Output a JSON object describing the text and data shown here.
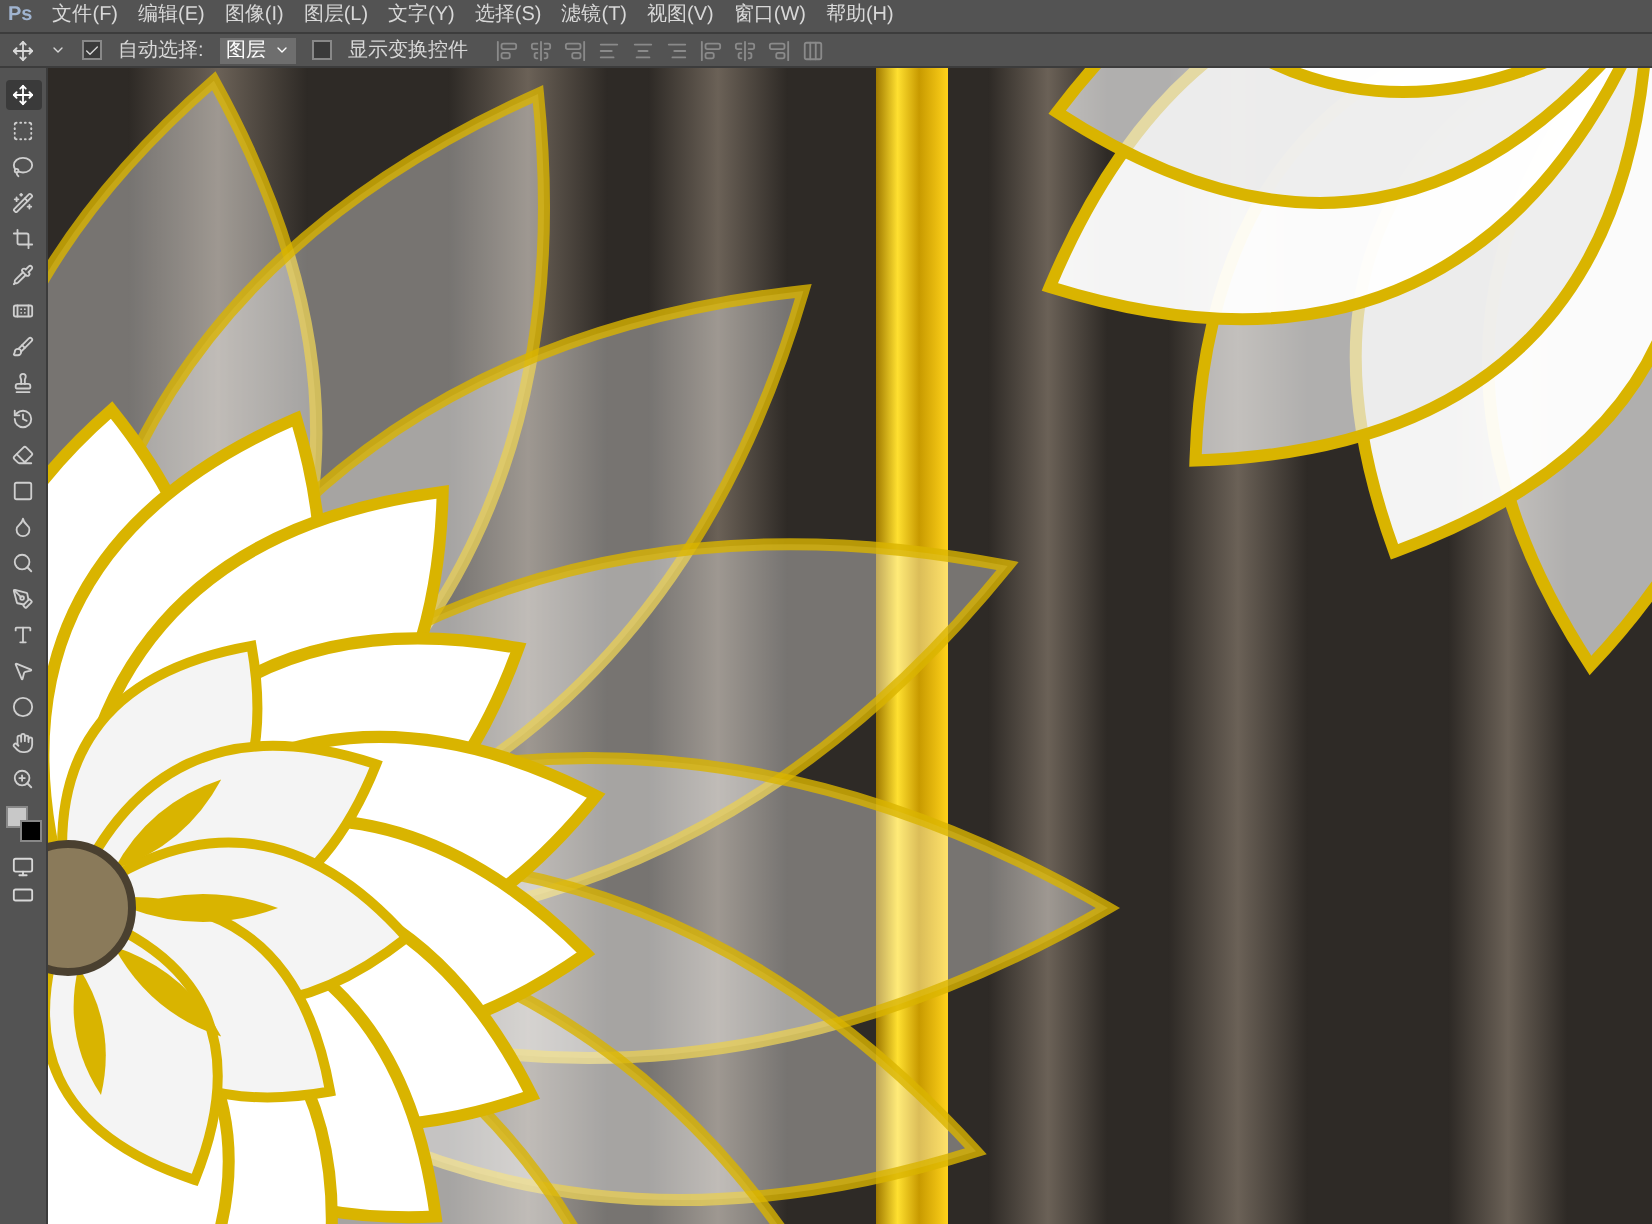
{
  "app_logo": "Ps",
  "menu": [
    "文件(F)",
    "编辑(E)",
    "图像(I)",
    "图层(L)",
    "文字(Y)",
    "选择(S)",
    "滤镜(T)",
    "视图(V)",
    "窗口(W)",
    "帮助(H)"
  ],
  "options_bar": {
    "auto_select": {
      "label": "自动选择:",
      "checked": true
    },
    "target": {
      "value": "图层"
    },
    "show_transform": {
      "label": "显示变换控件",
      "checked": false
    }
  },
  "tools": [
    {
      "kind": "move",
      "selected": true
    },
    {
      "kind": "marquee",
      "selected": false
    },
    {
      "kind": "lasso",
      "selected": false
    },
    {
      "kind": "quick_select",
      "selected": false
    },
    {
      "kind": "crop",
      "selected": false
    },
    {
      "kind": "eyedropper",
      "selected": false
    },
    {
      "kind": "healing",
      "selected": false
    },
    {
      "kind": "brush",
      "selected": false
    },
    {
      "kind": "stamp",
      "selected": false
    },
    {
      "kind": "history",
      "selected": false
    },
    {
      "kind": "eraser",
      "selected": false
    },
    {
      "kind": "gradient",
      "selected": false
    },
    {
      "kind": "blur",
      "selected": false
    },
    {
      "kind": "dodge",
      "selected": false
    },
    {
      "kind": "pen",
      "selected": false
    },
    {
      "kind": "type",
      "selected": false
    },
    {
      "kind": "path_select",
      "selected": false
    },
    {
      "kind": "shape",
      "selected": false
    },
    {
      "kind": "hand",
      "selected": false
    },
    {
      "kind": "zoom",
      "selected": false
    }
  ]
}
